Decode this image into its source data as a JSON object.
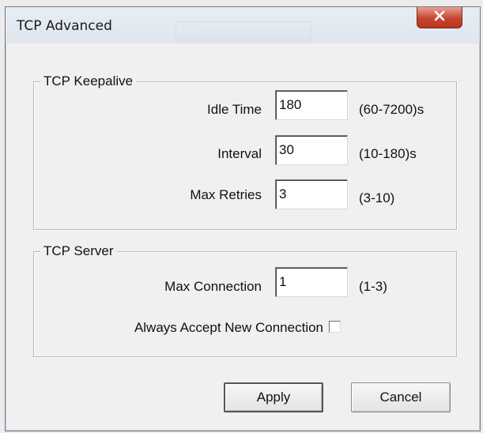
{
  "window": {
    "title": "TCP Advanced"
  },
  "keepalive": {
    "legend": "TCP Keepalive",
    "idle_time": {
      "label": "Idle Time",
      "value": "180",
      "range": "(60-7200)s"
    },
    "interval": {
      "label": "Interval",
      "value": "30",
      "range": "(10-180)s"
    },
    "max_retries": {
      "label": "Max Retries",
      "value": "3",
      "range": "(3-10)"
    }
  },
  "server": {
    "legend": "TCP Server",
    "max_connection": {
      "label": "Max Connection",
      "value": "1",
      "range": "(1-3)"
    },
    "always_accept": {
      "label": "Always Accept New Connection",
      "checked": false
    }
  },
  "buttons": {
    "apply": "Apply",
    "cancel": "Cancel"
  }
}
